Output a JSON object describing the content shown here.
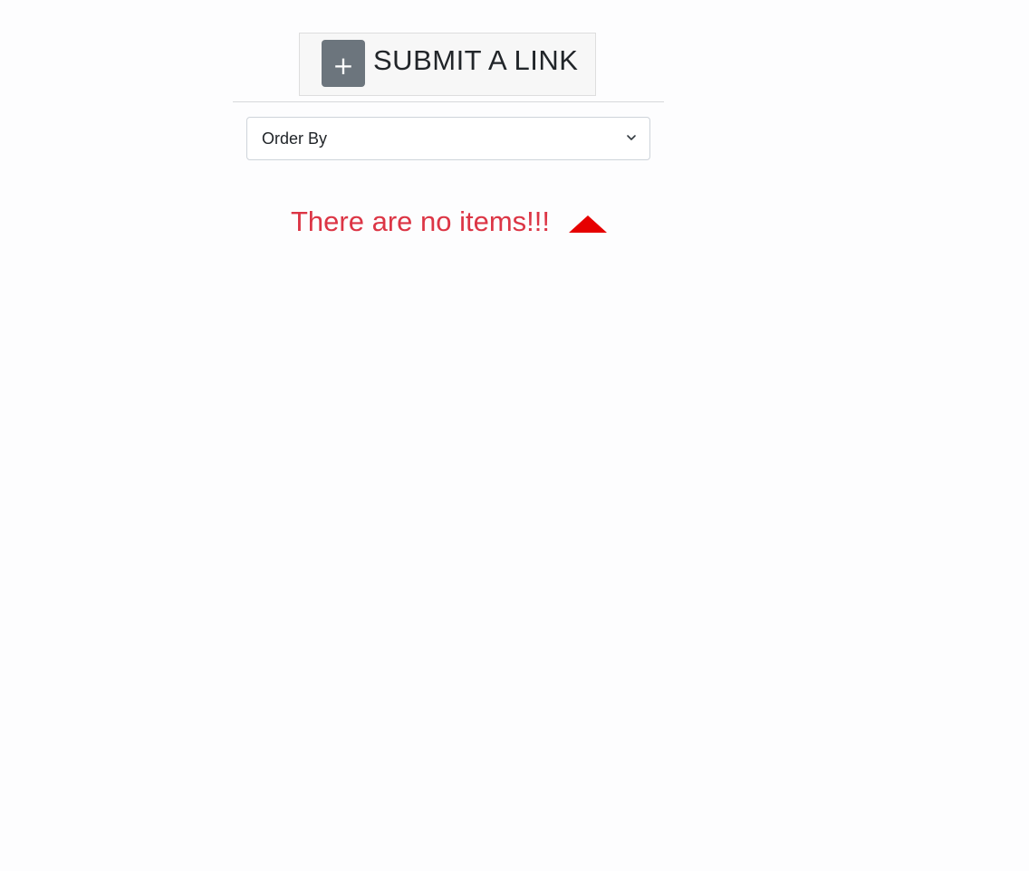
{
  "header": {
    "submit_icon": "plus-icon",
    "submit_plus_glyph": "+",
    "submit_label": "SUBMIT A LINK"
  },
  "order_select": {
    "selected": "Order By",
    "icon": "chevron-down-icon"
  },
  "empty_state": {
    "message": "There are no items!!!",
    "icon": "triangle-up-icon",
    "message_color": "#dc3545",
    "icon_color": "#e60000"
  },
  "colors": {
    "background": "#fdfdfe",
    "button_gray": "#6c757d",
    "text_dark": "#212529"
  }
}
